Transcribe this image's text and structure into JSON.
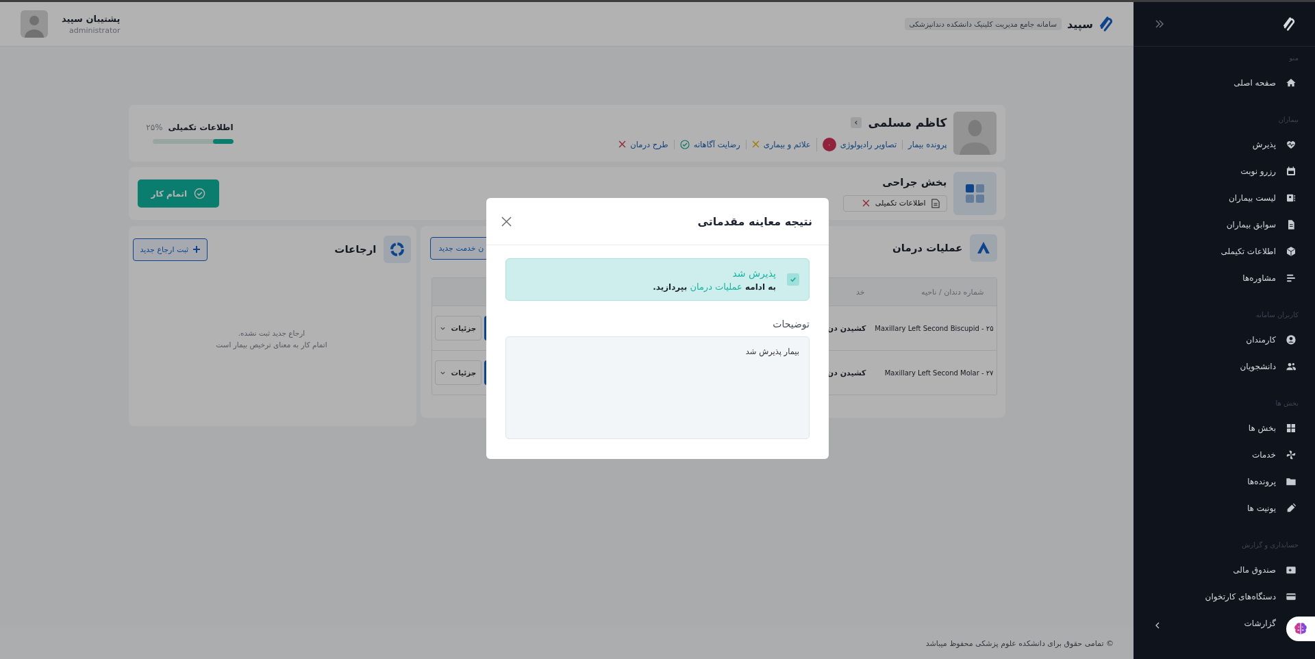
{
  "header": {
    "app_name": "سپید",
    "subtitle": "سامانه جامع مدیریت کلینیک دانشکده دندانپزشکی",
    "user": {
      "name": "پشتیبان سپید",
      "role": "administrator"
    }
  },
  "patient": {
    "name": "کاظم مسلمی",
    "links": [
      {
        "label": "پرونده بیمار",
        "kind": "plain"
      },
      {
        "label": "تصاویر رادیولوژی",
        "kind": "count",
        "count": "۰"
      },
      {
        "label": "علائم و بیماری",
        "kind": "pending"
      },
      {
        "label": "رضایت آگاهانه",
        "kind": "done"
      },
      {
        "label": "طرح درمان",
        "kind": "missing"
      }
    ],
    "completion": {
      "label": "اطلاعات تکمیلی",
      "percent": "۲۵%",
      "level": 0.25
    }
  },
  "section": {
    "title": "بخش جراحی",
    "tabs": [
      {
        "label": "اطلاعات تکمیلی",
        "kind": "missing"
      }
    ],
    "finish_button": "اتمام کار"
  },
  "treatments": {
    "title": "عملیات درمان",
    "add_button": "ن خدمت جدید",
    "columns": [
      "شماره دندان / ناحیه",
      "خد"
    ],
    "rows": [
      {
        "tooth": "Maxillary Left Second Biscupid - ۲۵",
        "service": "کشیدن دن",
        "details": "جزئیات"
      },
      {
        "tooth": "Maxillary Left Second Molar - ۲۷",
        "service": "کشیدن دن",
        "details": "جزئیات"
      }
    ]
  },
  "referrals": {
    "title": "ارجاعات",
    "add_button": "ثبت ارجاع جدید",
    "empty_lines": [
      "ارجاع جدید ثبت نشده.",
      "اتمام کار به معنای ترخیص بیمار است"
    ]
  },
  "modal": {
    "title": "نتیجه معاینه مقدماتی",
    "alert": {
      "title": "پذیرش شد",
      "text": "به ادامه **عملیات درمان** بپردازید.",
      "checked": true
    },
    "field_label": "توضیحات",
    "field_value": "بیمار پذیرش شد"
  },
  "sidebar": {
    "sections": [
      {
        "title": "منو",
        "items": [
          "صفحه اصلی"
        ]
      },
      {
        "title": "بیماران",
        "items": [
          "پذیرش",
          "رزرو نوبت",
          "لیست بیماران",
          "سوابق بیماران",
          "اطلاعات تکیملی",
          "مشاوره‌ها"
        ]
      },
      {
        "title": "کاربران سامانه",
        "items": [
          "کارمندان",
          "دانشجویان"
        ]
      },
      {
        "title": "بخش ها",
        "items": [
          "بخش ها",
          "خدمات",
          "پرونده‌ها",
          "یونیت ها"
        ]
      },
      {
        "title": "حسابداری و گزارش",
        "items": [
          "صندوق مالی",
          "دستگاه‌های کارتخوان",
          "گزارشات"
        ]
      }
    ]
  },
  "footer": "© تمامی حقوق برای دانشکده علوم پزشکی محفوظ میباشد"
}
